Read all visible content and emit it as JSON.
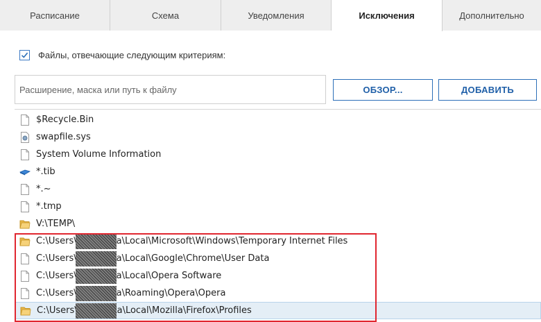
{
  "tabs": [
    {
      "label": "Расписание"
    },
    {
      "label": "Схема"
    },
    {
      "label": "Уведомления"
    },
    {
      "label": "Исключения",
      "active": true
    },
    {
      "label": "Дополнительно"
    }
  ],
  "criteria": {
    "label": "Файлы, отвечающие следующим критериям:",
    "checked": true
  },
  "path_input": {
    "placeholder": "Расширение, маска или путь к файлу",
    "value": ""
  },
  "buttons": {
    "browse": "ОБЗОР...",
    "add": "ДОБАВИТЬ"
  },
  "colors": {
    "accent": "#2c6fb8",
    "highlight_box": "#e0262f",
    "selection": "#e4eef6"
  },
  "exclusions": [
    {
      "text": "$Recycle.Bin",
      "icon": "file-icon"
    },
    {
      "text": "swapfile.sys",
      "icon": "system-file-icon"
    },
    {
      "text": "System Volume Information",
      "icon": "file-icon"
    },
    {
      "text": "*.tib",
      "icon": "backup-file-icon"
    },
    {
      "text": "*.~",
      "icon": "file-icon"
    },
    {
      "text": "*.tmp",
      "icon": "file-icon"
    },
    {
      "text": "V:\\TEMP\\",
      "icon": "folder-icon"
    },
    {
      "text": "C:\\Users\\          \\AppData\\Local\\Microsoft\\Windows\\Temporary Internet Files",
      "icon": "folder-icon"
    },
    {
      "text": "C:\\Users\\          \\AppData\\Local\\Google\\Chrome\\User Data",
      "icon": "file-icon"
    },
    {
      "text": "C:\\Users\\          \\AppData\\Local\\Opera Software",
      "icon": "file-icon"
    },
    {
      "text": "C:\\Users\\          \\AppData\\Roaming\\Opera\\Opera",
      "icon": "file-icon"
    },
    {
      "text": "C:\\Users\\          \\AppData\\Local\\Mozilla\\Firefox\\Profiles",
      "icon": "folder-icon",
      "selected": true
    }
  ]
}
